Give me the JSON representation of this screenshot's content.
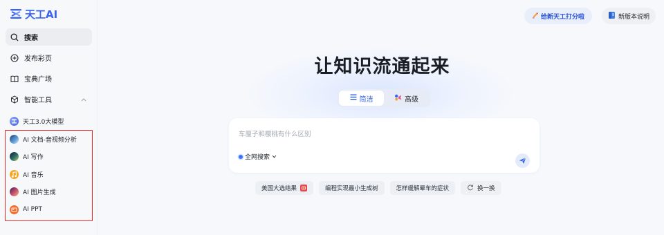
{
  "app": {
    "logo_text": "天工AI",
    "brand_color": "#3a64f0"
  },
  "sidebar": {
    "nav": [
      {
        "label": "搜索",
        "icon": "search-icon",
        "active": true
      },
      {
        "label": "发布彩页",
        "icon": "plus-circle-icon"
      },
      {
        "label": "宝典广场",
        "icon": "book-icon"
      },
      {
        "label": "智能工具",
        "icon": "cube-icon"
      }
    ],
    "tools": [
      {
        "label": "天工3.0大模型",
        "icon": "tiangong-avatar-icon"
      },
      {
        "label": "AI 文档-音视频分析",
        "icon": "doc-analysis-avatar-icon"
      },
      {
        "label": "AI 写作",
        "icon": "writing-avatar-icon"
      },
      {
        "label": "AI 音乐",
        "icon": "music-avatar-icon"
      },
      {
        "label": "AI 图片生成",
        "icon": "image-avatar-icon"
      },
      {
        "label": "AI PPT",
        "icon": "ppt-avatar-icon"
      }
    ],
    "highlight_color": "#e02626"
  },
  "header": {
    "invite_label": "给新天工打分啦",
    "notes_label": "新版本说明"
  },
  "main": {
    "title": "让知识流通起来",
    "modes": [
      {
        "label": "简洁",
        "icon": "list-icon",
        "active": true
      },
      {
        "label": "高级",
        "icon": "advanced-icon"
      }
    ],
    "search": {
      "placeholder": "车厘子和樱桃有什么区别",
      "scope_label": "全网搜索"
    },
    "suggestions": [
      {
        "label": "美国大选结果"
      },
      {
        "label": "编程实现最小生成树"
      },
      {
        "label": "怎样缓解晕车的症状"
      },
      {
        "label": "换一换"
      }
    ]
  }
}
